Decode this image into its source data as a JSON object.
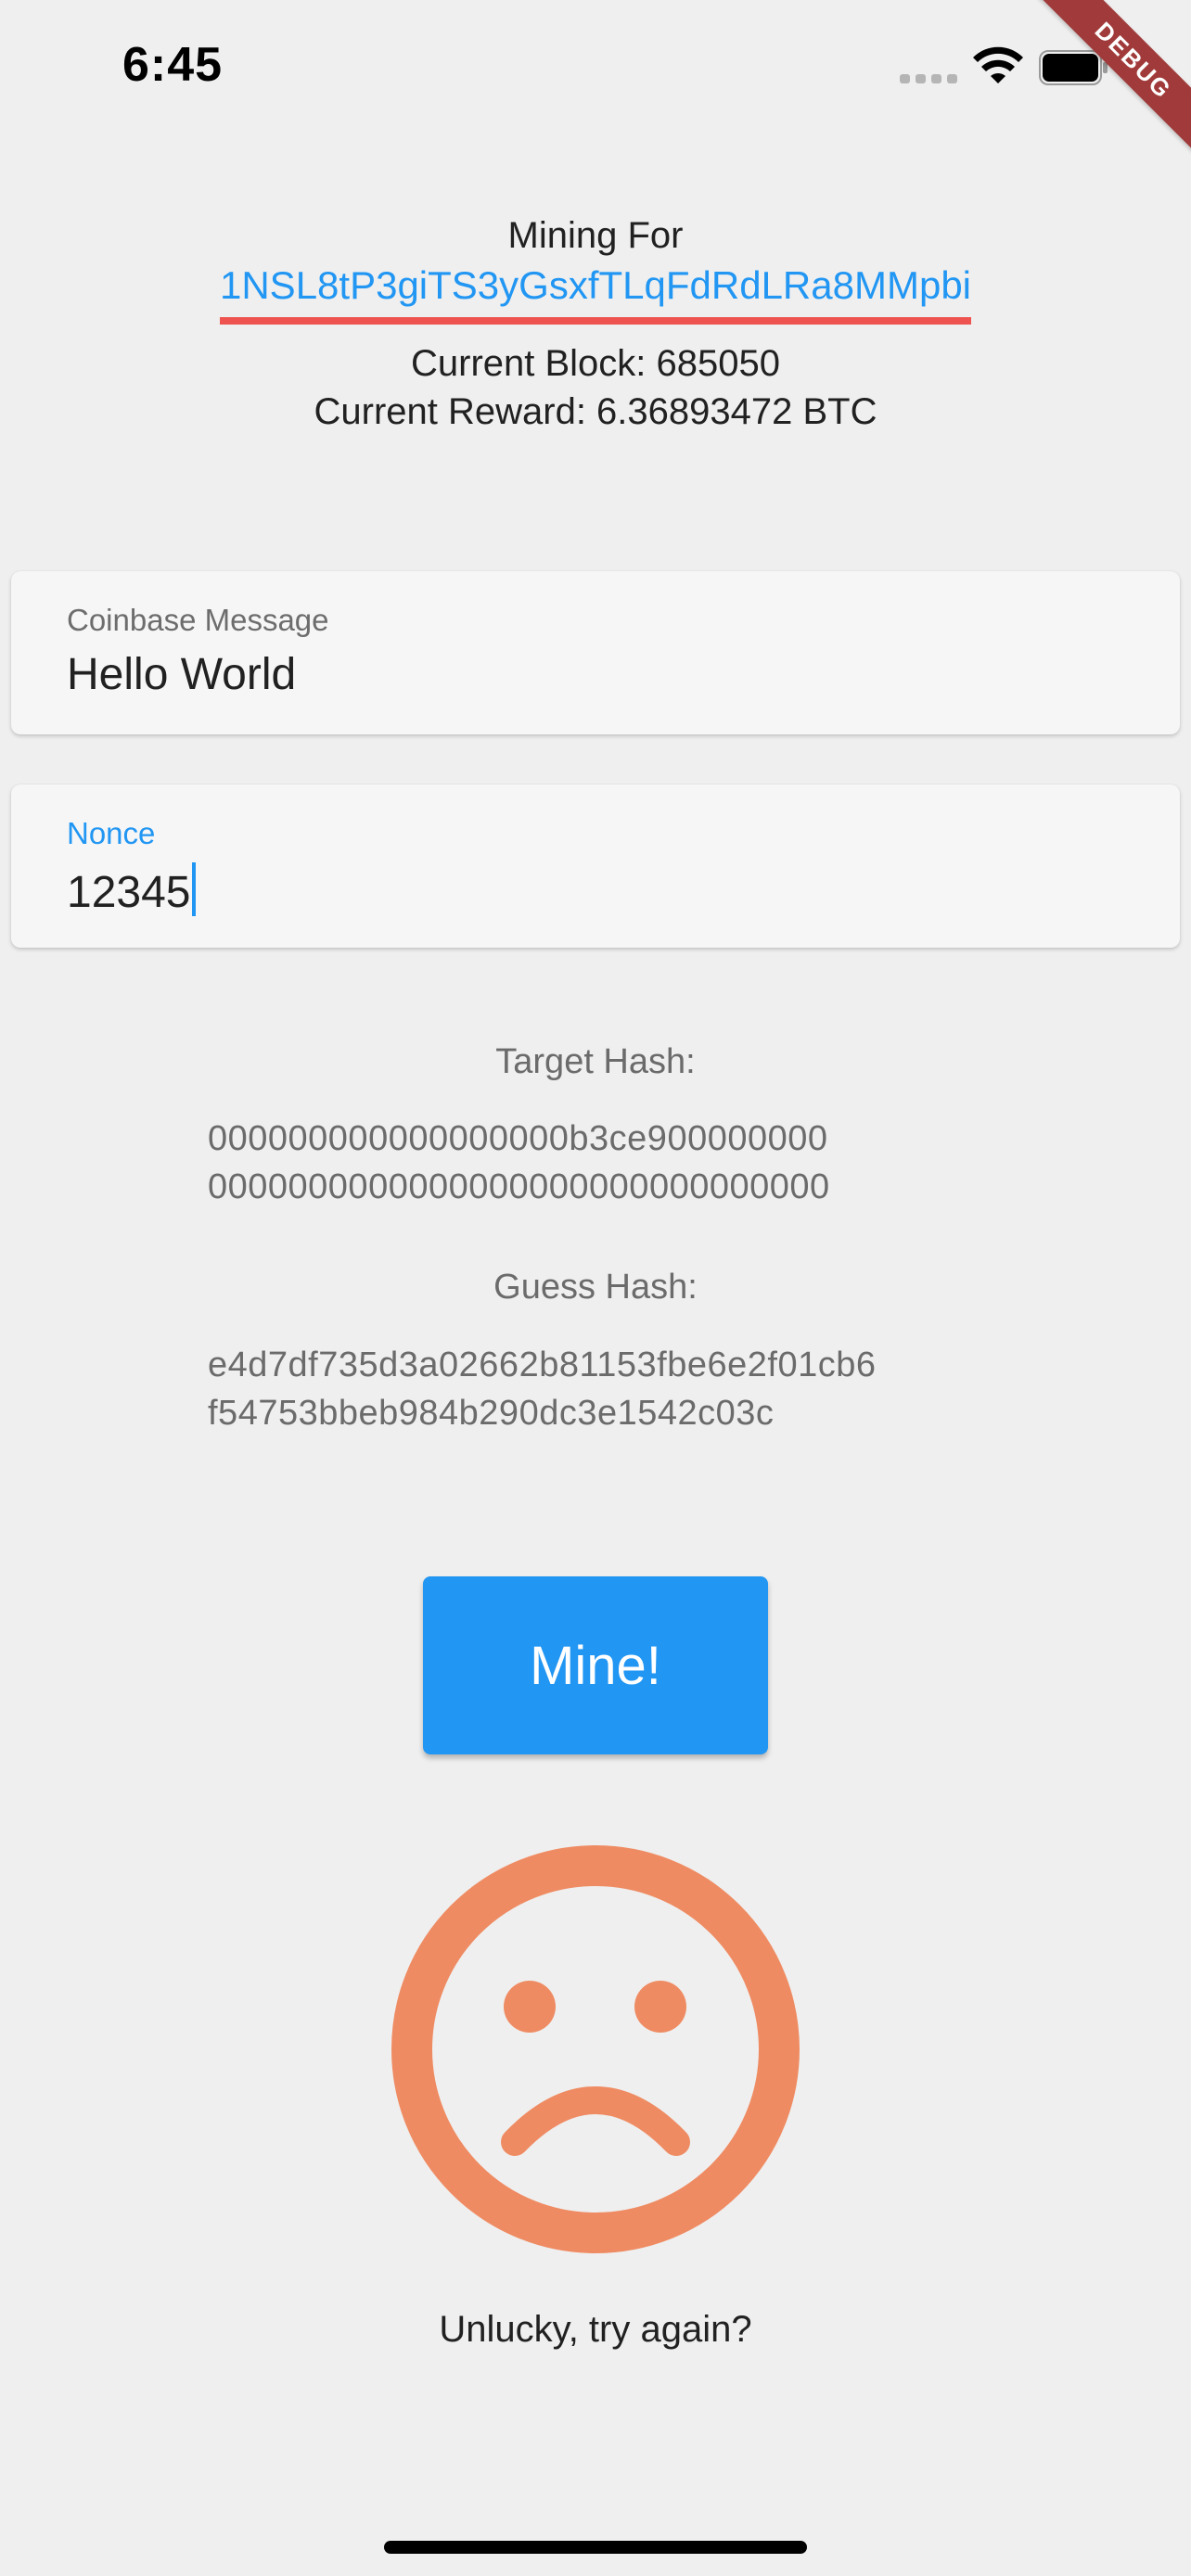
{
  "status_bar": {
    "time": "6:45",
    "debug_banner": "DEBUG"
  },
  "header": {
    "mining_for_label": "Mining For",
    "address": "1NSL8tP3giTS3yGsxfTLqFdRdLRa8MMpbi",
    "current_block": "Current Block: 685050",
    "current_reward": "Current Reward: 6.36893472 BTC"
  },
  "coinbase_field": {
    "label": "Coinbase Message",
    "value": "Hello World"
  },
  "nonce_field": {
    "label": "Nonce",
    "value": "12345"
  },
  "target_hash": {
    "title": "Target Hash:",
    "line1": "000000000000000000b3ce900000000",
    "line2": "0000000000000000000000000000000"
  },
  "guess_hash": {
    "title": "Guess Hash:",
    "line1": "e4d7df735d3a02662b81153fbe6e2f01cb6",
    "line2": "f54753bbeb984b290dc3e1542c03c"
  },
  "mine_button": {
    "label": "Mine!"
  },
  "result": {
    "icon": "sad-face-icon",
    "message": "Unlucky, try again?"
  },
  "colors": {
    "accent": "#2196f3",
    "underline": "#ef5350",
    "sad_face": "#ef8b62",
    "background": "#efefef"
  }
}
